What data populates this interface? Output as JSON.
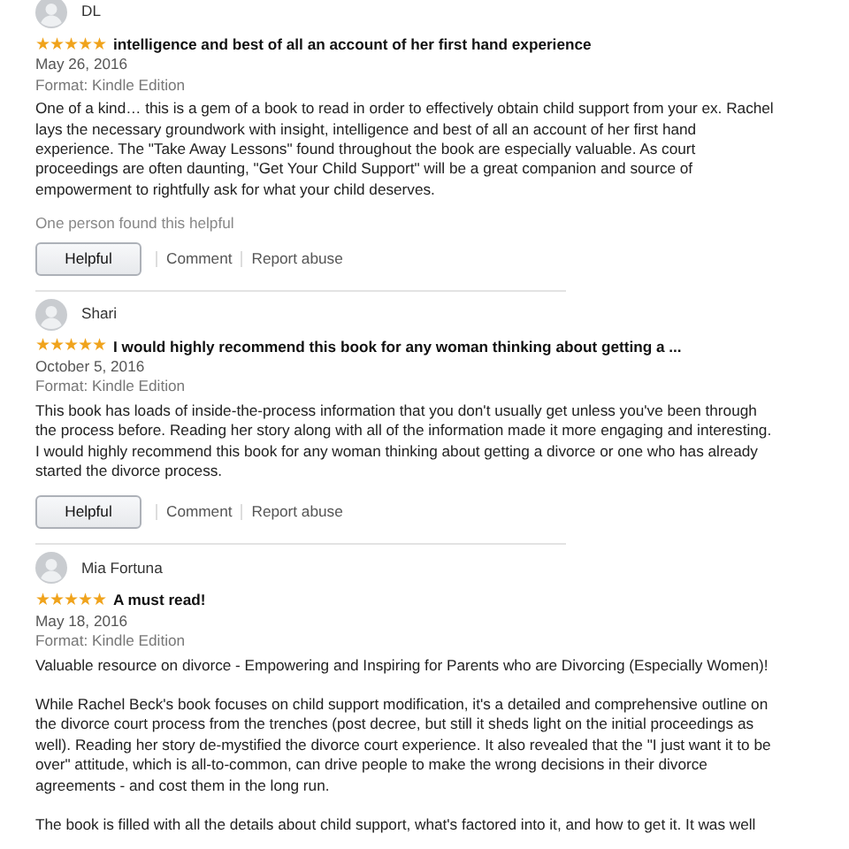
{
  "reviews": [
    {
      "author": "DL",
      "stars": 5,
      "title": "intelligence and best of all an account of her first hand experience",
      "date": "May 26, 2016",
      "format": "Format: Kindle Edition",
      "paragraphs": [
        "One of a kind… this is a gem of a book to read in order to effectively obtain child support from your ex. Rachel lays the necessary groundwork with insight, intelligence and best of all an account of her first hand experience. The \"Take Away Lessons\" found throughout the book are especially valuable. As court proceedings are often daunting, \"Get Your Child Support\" will be a great companion and source of empowerment to rightfully ask for what your child deserves."
      ],
      "helpful_count": "One person found this helpful",
      "actions": {
        "helpful": "Helpful",
        "comment": "Comment",
        "report": "Report abuse"
      }
    },
    {
      "author": "Shari",
      "stars": 5,
      "title": "I would highly recommend this book for any woman thinking about getting a ...",
      "date": "October 5, 2016",
      "format": "Format: Kindle Edition",
      "paragraphs": [
        "This book has loads of inside-the-process information that you don't usually get unless you've been through the process before. Reading her story along with all of the information made it more engaging and interesting. I would highly recommend this book for any woman thinking about getting a divorce or one who has already started the divorce process."
      ],
      "actions": {
        "helpful": "Helpful",
        "comment": "Comment",
        "report": "Report abuse"
      }
    },
    {
      "author": "Mia Fortuna",
      "stars": 5,
      "title": "A must read!",
      "date": "May 18, 2016",
      "format": "Format: Kindle Edition",
      "paragraphs": [
        "Valuable resource on divorce - Empowering and Inspiring for Parents who are Divorcing (Especially Women)!",
        "While Rachel Beck's book focuses on child support modification, it's a detailed and comprehensive outline on the divorce court process from the trenches (post decree, but still it sheds light on the initial proceedings as well). Reading her story de-mystified the divorce court experience. It also revealed that the \"I just want it to be over\" attitude, which is all-to-common, can drive people to make the wrong decisions in their divorce agreements - and cost them in the long run.",
        "The book is filled with all the details about child support, what's factored into it, and how to get it. It was well"
      ]
    }
  ]
}
